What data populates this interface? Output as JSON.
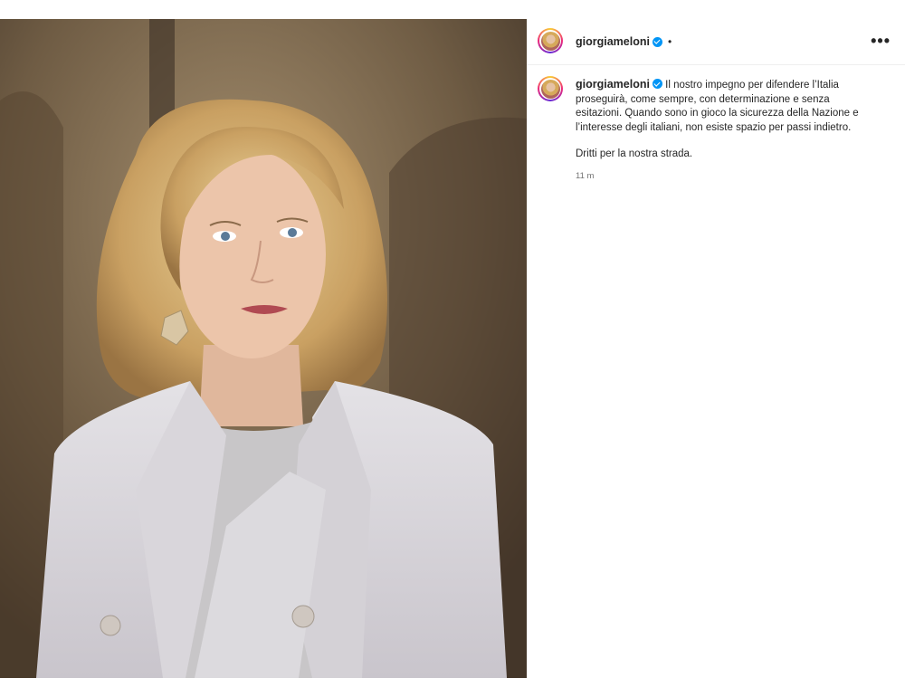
{
  "post": {
    "username": "giorgiameloni",
    "header_dot": "•",
    "more_label": "•••",
    "caption_line1": "Il nostro impegno per difendere l’Italia proseguirà, come sempre, con determinazione e senza esitazioni. Quando sono in gioco la sicurezza della Nazione e l’interesse degli italiani, non esiste spazio per passi indietro.",
    "caption_line2": "Dritti per la nostra strada.",
    "timestamp": "11 m"
  },
  "colors": {
    "verified": "#0095f6",
    "text": "#262626",
    "muted": "#737373"
  },
  "icons": [
    "verified-badge-icon",
    "more-options-icon"
  ]
}
